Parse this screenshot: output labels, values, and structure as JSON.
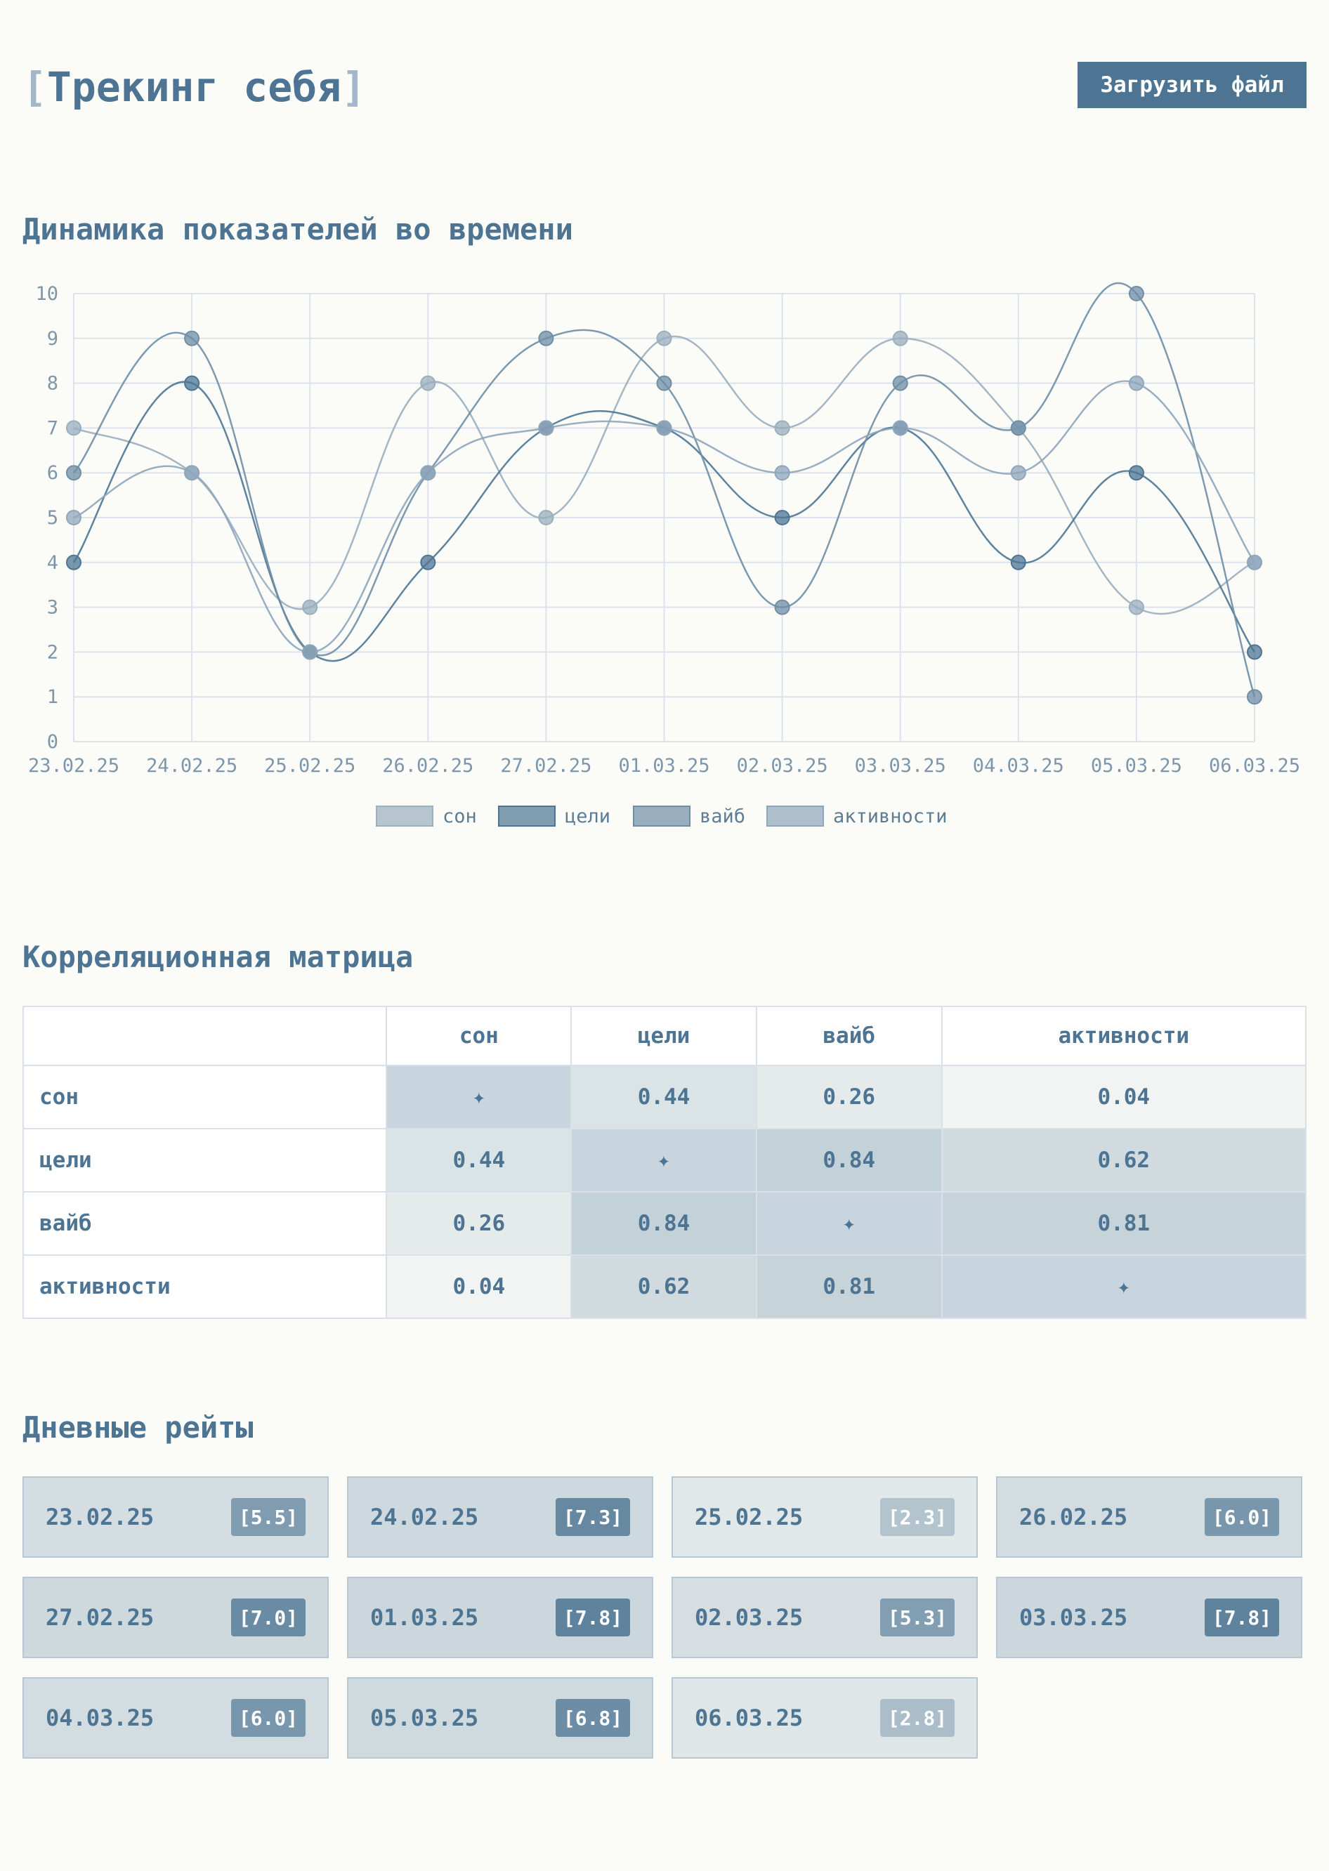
{
  "header": {
    "bracket_open": "[",
    "title": "Трекинг себя",
    "bracket_close": "]",
    "upload_label": "Загрузить файл"
  },
  "sections": {
    "dynamics": "Динамика показателей во времени",
    "correlation": "Корреляционная матрица",
    "daily": "Дневные рейты"
  },
  "chart_data": {
    "type": "line",
    "x": [
      "23.02.25",
      "24.02.25",
      "25.02.25",
      "26.02.25",
      "27.02.25",
      "01.03.25",
      "02.03.25",
      "03.03.25",
      "04.03.25",
      "05.03.25",
      "06.03.25"
    ],
    "ylim": [
      0,
      10
    ],
    "yticks": [
      0,
      1,
      2,
      3,
      4,
      5,
      6,
      7,
      8,
      9,
      10
    ],
    "grid": true,
    "legend_position": "bottom",
    "series": [
      {
        "name": "сон",
        "values": [
          7,
          6,
          3,
          8,
          5,
          9,
          7,
          9,
          7,
          3,
          4
        ],
        "color": "#9aaebe"
      },
      {
        "name": "цели",
        "values": [
          4,
          8,
          2,
          4,
          7,
          7,
          5,
          7,
          4,
          6,
          2
        ],
        "color": "#4d7593"
      },
      {
        "name": "вайб",
        "values": [
          6,
          9,
          2,
          6,
          9,
          8,
          3,
          8,
          7,
          10,
          1
        ],
        "color": "#6f8ea6"
      },
      {
        "name": "активности",
        "values": [
          5,
          6,
          2,
          6,
          7,
          7,
          6,
          7,
          6,
          8,
          4
        ],
        "color": "#8fa5bb"
      }
    ]
  },
  "correlation": {
    "headers": [
      "сон",
      "цели",
      "вайб",
      "активности"
    ],
    "diagonal_symbol": "✦",
    "rows": [
      {
        "label": "сон",
        "cells": [
          "✦",
          "0.44",
          "0.26",
          "0.04"
        ]
      },
      {
        "label": "цели",
        "cells": [
          "0.44",
          "✦",
          "0.84",
          "0.62"
        ]
      },
      {
        "label": "вайб",
        "cells": [
          "0.26",
          "0.84",
          "✦",
          "0.81"
        ]
      },
      {
        "label": "активности",
        "cells": [
          "0.04",
          "0.62",
          "0.81",
          "✦"
        ]
      }
    ]
  },
  "daily": [
    {
      "date": "23.02.25",
      "rate": "[5.5]"
    },
    {
      "date": "24.02.25",
      "rate": "[7.3]"
    },
    {
      "date": "25.02.25",
      "rate": "[2.3]"
    },
    {
      "date": "26.02.25",
      "rate": "[6.0]"
    },
    {
      "date": "27.02.25",
      "rate": "[7.0]"
    },
    {
      "date": "01.03.25",
      "rate": "[7.8]"
    },
    {
      "date": "02.03.25",
      "rate": "[5.3]"
    },
    {
      "date": "03.03.25",
      "rate": "[7.8]"
    },
    {
      "date": "04.03.25",
      "rate": "[6.0]"
    },
    {
      "date": "05.03.25",
      "rate": "[6.8]"
    },
    {
      "date": "06.03.25",
      "rate": "[2.8]"
    }
  ]
}
